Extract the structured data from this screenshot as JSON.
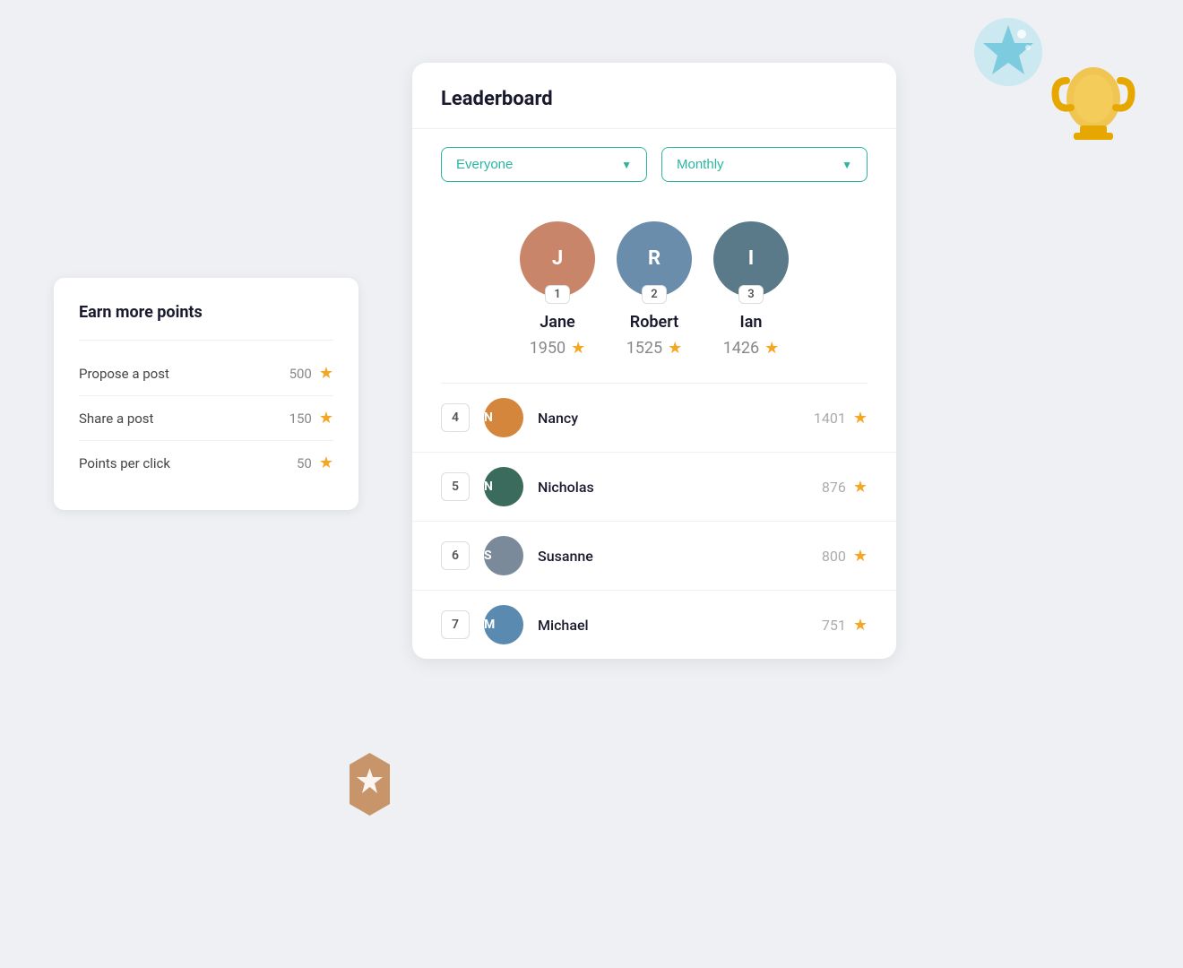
{
  "earn_card": {
    "title": "Earn more points",
    "rows": [
      {
        "label": "Propose a post",
        "points": "500"
      },
      {
        "label": "Share a post",
        "points": "150"
      },
      {
        "label": "Points per click",
        "points": "50"
      }
    ]
  },
  "leaderboard": {
    "title": "Leaderboard",
    "filter_group": "Everyone",
    "filter_period": "Monthly",
    "top3": [
      {
        "rank": "1",
        "name": "Jane",
        "score": "1950",
        "bg": "avatar-bg-1",
        "initials": "J"
      },
      {
        "rank": "2",
        "name": "Robert",
        "score": "1525",
        "bg": "avatar-bg-2",
        "initials": "R"
      },
      {
        "rank": "3",
        "name": "Ian",
        "score": "1426",
        "bg": "avatar-bg-3",
        "initials": "I"
      }
    ],
    "list": [
      {
        "rank": "4",
        "name": "Nancy",
        "score": "1401",
        "bg": "avatar-bg-4",
        "initials": "N"
      },
      {
        "rank": "5",
        "name": "Nicholas",
        "score": "876",
        "bg": "avatar-bg-5",
        "initials": "N"
      },
      {
        "rank": "6",
        "name": "Susanne",
        "score": "800",
        "bg": "avatar-bg-6",
        "initials": "S"
      },
      {
        "rank": "7",
        "name": "Michael",
        "score": "751",
        "bg": "avatar-bg-7",
        "initials": "M"
      }
    ]
  }
}
